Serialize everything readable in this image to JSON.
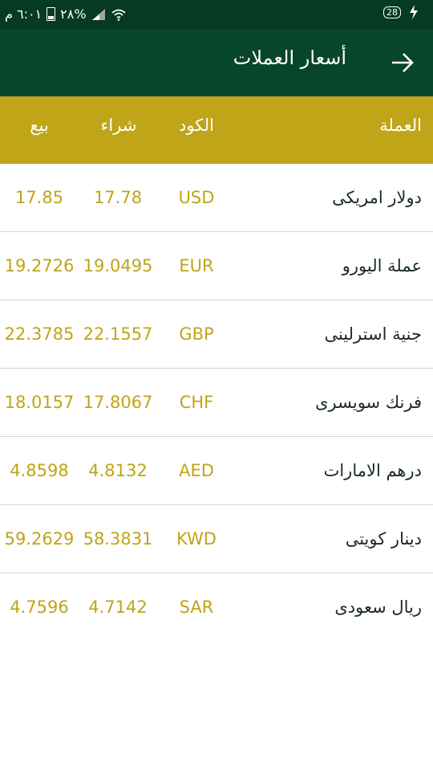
{
  "status_bar": {
    "time": "٦:٠١ م",
    "battery_percent": "٢٨%",
    "notification_badge": "28"
  },
  "app_bar": {
    "title": "أسعار العملات"
  },
  "table": {
    "headers": {
      "currency": "العملة",
      "code": "الكود",
      "buy": "شراء",
      "sell": "بيع"
    },
    "rows": [
      {
        "name": "دولار امريكى",
        "code": "USD",
        "buy": "17.78",
        "sell": "17.85"
      },
      {
        "name": "عملة اليورو",
        "code": "EUR",
        "buy": "19.0495",
        "sell": "19.2726"
      },
      {
        "name": "جنية استرلينى",
        "code": "GBP",
        "buy": "22.1557",
        "sell": "22.3785"
      },
      {
        "name": "فرنك سويسرى",
        "code": "CHF",
        "buy": "17.8067",
        "sell": "18.0157"
      },
      {
        "name": "درهم الامارات",
        "code": "AED",
        "buy": "4.8132",
        "sell": "4.8598"
      },
      {
        "name": "دينار كويتى",
        "code": "KWD",
        "buy": "58.3831",
        "sell": "59.2629"
      },
      {
        "name": "ريال سعودى",
        "code": "SAR",
        "buy": "4.7142",
        "sell": "4.7596"
      }
    ]
  },
  "colors": {
    "status_bar": "#063a23",
    "app_bar": "#08462b",
    "header_bg": "#bfa517",
    "value_text": "#bfa517"
  }
}
